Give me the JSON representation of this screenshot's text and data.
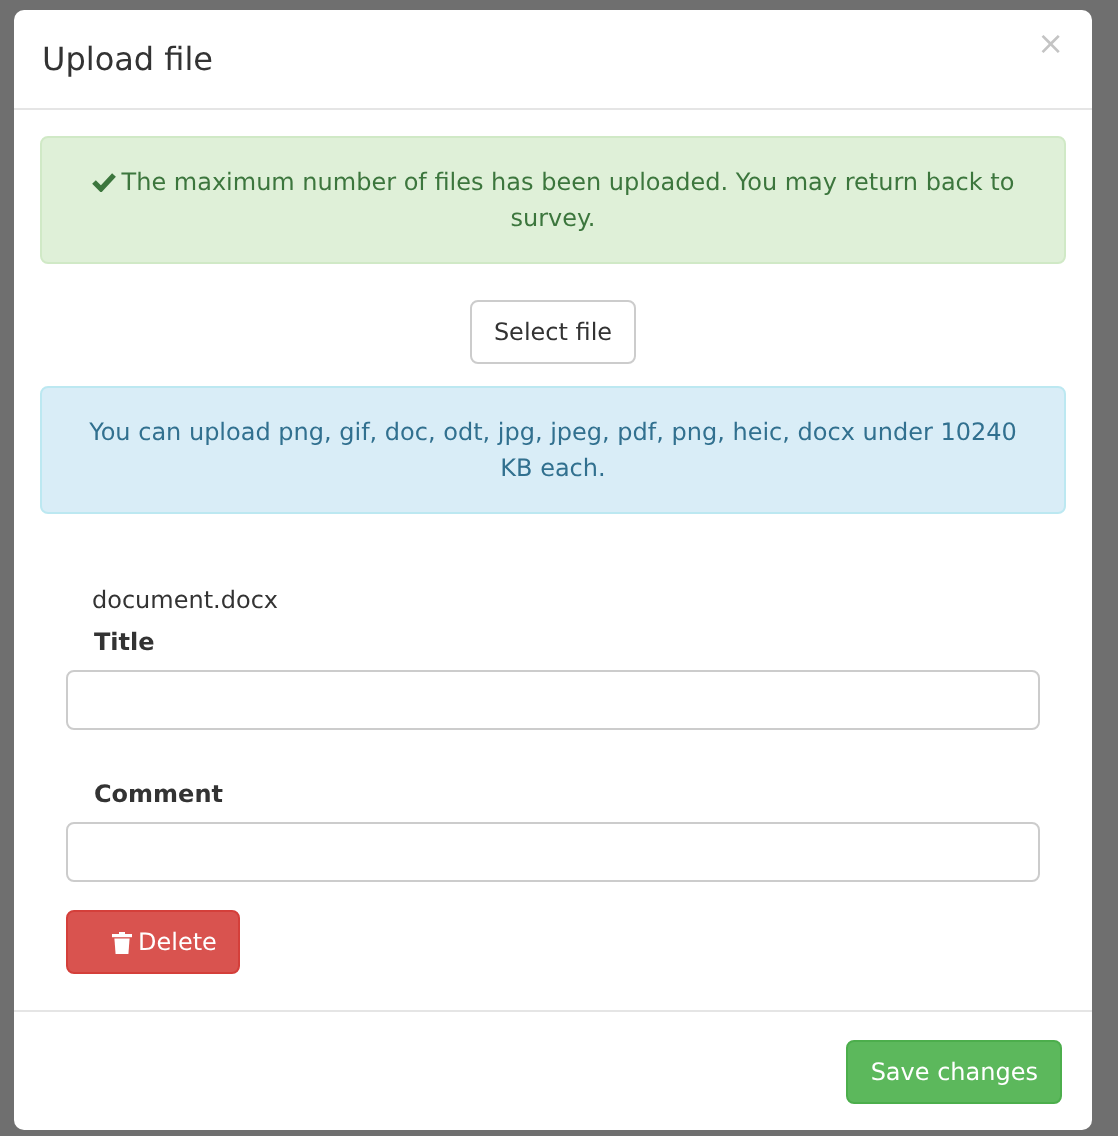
{
  "modal": {
    "title": "Upload file",
    "close": "×"
  },
  "success_alert": {
    "text": "The maximum number of files has been uploaded. You may return back to survey."
  },
  "select_button": {
    "label": "Select file"
  },
  "info_alert": {
    "text": "You can upload png, gif, doc, odt, jpg, jpeg, pdf, png, heic, docx under 10240 KB each."
  },
  "files": [
    {
      "filename": "document.docx",
      "fields": [
        {
          "label": "Title"
        },
        {
          "label": "Comment"
        }
      ],
      "delete_label": "Delete"
    }
  ],
  "footer": {
    "save_label": "Save changes"
  }
}
